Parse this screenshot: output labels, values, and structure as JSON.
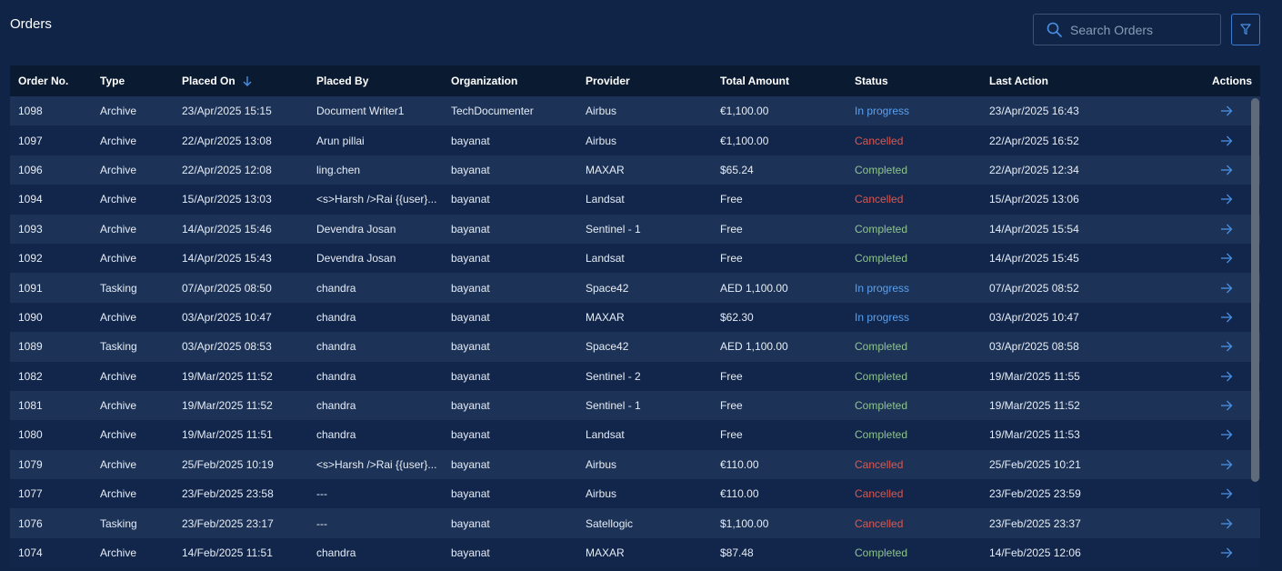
{
  "page": {
    "title": "Orders"
  },
  "search": {
    "placeholder": "Search Orders",
    "icon": "search-icon"
  },
  "filter": {
    "icon": "filter-icon"
  },
  "colors": {
    "background": "#0f2447",
    "header": "#0a1a30",
    "row_odd": "#1c3357",
    "row_even": "#11264a",
    "accent": "#3b7bd4",
    "in_progress": "#5aa0f0",
    "cancelled": "#e0564e",
    "completed": "#8fc38f"
  },
  "table": {
    "columns": [
      "Order No.",
      "Type",
      "Placed On",
      "Placed By",
      "Organization",
      "Provider",
      "Total Amount",
      "Status",
      "Last Action",
      "Actions"
    ],
    "rows": [
      {
        "no": "1098",
        "type": "Archive",
        "placed_on": "23/Apr/2025 15:15",
        "placed_by": "Document Writer1",
        "org": "TechDocumenter",
        "provider": "Airbus",
        "amount": "€1,100.00",
        "status": "In progress",
        "last": "23/Apr/2025 16:43"
      },
      {
        "no": "1097",
        "type": "Archive",
        "placed_on": "22/Apr/2025 13:08",
        "placed_by": "Arun pillai",
        "org": "bayanat",
        "provider": "Airbus",
        "amount": "€1,100.00",
        "status": "Cancelled",
        "last": "22/Apr/2025 16:52"
      },
      {
        "no": "1096",
        "type": "Archive",
        "placed_on": "22/Apr/2025 12:08",
        "placed_by": "ling.chen",
        "org": "bayanat",
        "provider": "MAXAR",
        "amount": "$65.24",
        "status": "Completed",
        "last": "22/Apr/2025 12:34"
      },
      {
        "no": "1094",
        "type": "Archive",
        "placed_on": "15/Apr/2025 13:03",
        "placed_by": "<s>Harsh />Rai {{user}...",
        "org": "bayanat",
        "provider": "Landsat",
        "amount": "Free",
        "status": "Cancelled",
        "last": "15/Apr/2025 13:06"
      },
      {
        "no": "1093",
        "type": "Archive",
        "placed_on": "14/Apr/2025 15:46",
        "placed_by": "Devendra Josan",
        "org": "bayanat",
        "provider": "Sentinel - 1",
        "amount": "Free",
        "status": "Completed",
        "last": "14/Apr/2025 15:54"
      },
      {
        "no": "1092",
        "type": "Archive",
        "placed_on": "14/Apr/2025 15:43",
        "placed_by": "Devendra Josan",
        "org": "bayanat",
        "provider": "Landsat",
        "amount": "Free",
        "status": "Completed",
        "last": "14/Apr/2025 15:45"
      },
      {
        "no": "1091",
        "type": "Tasking",
        "placed_on": "07/Apr/2025 08:50",
        "placed_by": "chandra",
        "org": "bayanat",
        "provider": "Space42",
        "amount": "AED 1,100.00",
        "status": "In progress",
        "last": "07/Apr/2025 08:52"
      },
      {
        "no": "1090",
        "type": "Archive",
        "placed_on": "03/Apr/2025 10:47",
        "placed_by": "chandra",
        "org": "bayanat",
        "provider": "MAXAR",
        "amount": "$62.30",
        "status": "In progress",
        "last": "03/Apr/2025 10:47"
      },
      {
        "no": "1089",
        "type": "Tasking",
        "placed_on": "03/Apr/2025 08:53",
        "placed_by": "chandra",
        "org": "bayanat",
        "provider": "Space42",
        "amount": "AED 1,100.00",
        "status": "Completed",
        "last": "03/Apr/2025 08:58"
      },
      {
        "no": "1082",
        "type": "Archive",
        "placed_on": "19/Mar/2025 11:52",
        "placed_by": "chandra",
        "org": "bayanat",
        "provider": "Sentinel - 2",
        "amount": "Free",
        "status": "Completed",
        "last": "19/Mar/2025 11:55"
      },
      {
        "no": "1081",
        "type": "Archive",
        "placed_on": "19/Mar/2025 11:52",
        "placed_by": "chandra",
        "org": "bayanat",
        "provider": "Sentinel - 1",
        "amount": "Free",
        "status": "Completed",
        "last": "19/Mar/2025 11:52"
      },
      {
        "no": "1080",
        "type": "Archive",
        "placed_on": "19/Mar/2025 11:51",
        "placed_by": "chandra",
        "org": "bayanat",
        "provider": "Landsat",
        "amount": "Free",
        "status": "Completed",
        "last": "19/Mar/2025 11:53"
      },
      {
        "no": "1079",
        "type": "Archive",
        "placed_on": "25/Feb/2025 10:19",
        "placed_by": "<s>Harsh />Rai {{user}...",
        "org": "bayanat",
        "provider": "Airbus",
        "amount": "€110.00",
        "status": "Cancelled",
        "last": "25/Feb/2025 10:21"
      },
      {
        "no": "1077",
        "type": "Archive",
        "placed_on": "23/Feb/2025 23:58",
        "placed_by": "---",
        "org": "bayanat",
        "provider": "Airbus",
        "amount": "€110.00",
        "status": "Cancelled",
        "last": "23/Feb/2025 23:59"
      },
      {
        "no": "1076",
        "type": "Tasking",
        "placed_on": "23/Feb/2025 23:17",
        "placed_by": "---",
        "org": "bayanat",
        "provider": "Satellogic",
        "amount": "$1,100.00",
        "status": "Cancelled",
        "last": "23/Feb/2025 23:37"
      },
      {
        "no": "1074",
        "type": "Archive",
        "placed_on": "14/Feb/2025 11:51",
        "placed_by": "chandra",
        "org": "bayanat",
        "provider": "MAXAR",
        "amount": "$87.48",
        "status": "Completed",
        "last": "14/Feb/2025 12:06"
      }
    ]
  }
}
